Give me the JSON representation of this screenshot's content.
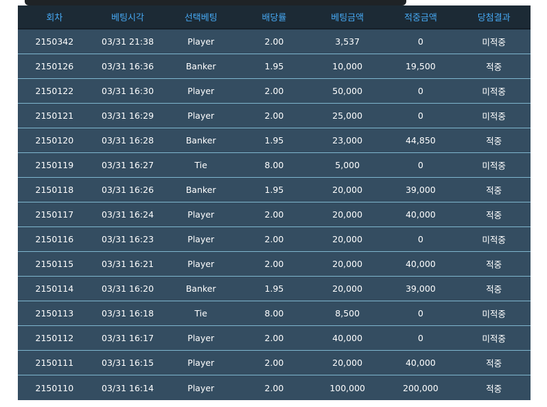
{
  "table": {
    "headers": [
      "회차",
      "베팅시각",
      "선택베팅",
      "배당률",
      "베팅금액",
      "적중금액",
      "당첨결과"
    ],
    "rows": [
      {
        "round": "2150342",
        "time": "03/31 21:38",
        "bet": "Player",
        "odds": "2.00",
        "amount": "3,537",
        "win_amount": "0",
        "result": "미적중",
        "status": "lose"
      },
      {
        "round": "2150126",
        "time": "03/31 16:36",
        "bet": "Banker",
        "odds": "1.95",
        "amount": "10,000",
        "win_amount": "19,500",
        "result": "적중",
        "status": "win"
      },
      {
        "round": "2150122",
        "time": "03/31 16:30",
        "bet": "Player",
        "odds": "2.00",
        "amount": "50,000",
        "win_amount": "0",
        "result": "미적중",
        "status": "lose"
      },
      {
        "round": "2150121",
        "time": "03/31 16:29",
        "bet": "Player",
        "odds": "2.00",
        "amount": "25,000",
        "win_amount": "0",
        "result": "미적중",
        "status": "lose"
      },
      {
        "round": "2150120",
        "time": "03/31 16:28",
        "bet": "Banker",
        "odds": "1.95",
        "amount": "23,000",
        "win_amount": "44,850",
        "result": "적중",
        "status": "win"
      },
      {
        "round": "2150119",
        "time": "03/31 16:27",
        "bet": "Tie",
        "odds": "8.00",
        "amount": "5,000",
        "win_amount": "0",
        "result": "미적중",
        "status": "lose"
      },
      {
        "round": "2150118",
        "time": "03/31 16:26",
        "bet": "Banker",
        "odds": "1.95",
        "amount": "20,000",
        "win_amount": "39,000",
        "result": "적중",
        "status": "win"
      },
      {
        "round": "2150117",
        "time": "03/31 16:24",
        "bet": "Player",
        "odds": "2.00",
        "amount": "20,000",
        "win_amount": "40,000",
        "result": "적중",
        "status": "win"
      },
      {
        "round": "2150116",
        "time": "03/31 16:23",
        "bet": "Player",
        "odds": "2.00",
        "amount": "20,000",
        "win_amount": "0",
        "result": "미적중",
        "status": "lose"
      },
      {
        "round": "2150115",
        "time": "03/31 16:21",
        "bet": "Player",
        "odds": "2.00",
        "amount": "20,000",
        "win_amount": "40,000",
        "result": "적중",
        "status": "win"
      },
      {
        "round": "2150114",
        "time": "03/31 16:20",
        "bet": "Banker",
        "odds": "1.95",
        "amount": "20,000",
        "win_amount": "39,000",
        "result": "적중",
        "status": "win"
      },
      {
        "round": "2150113",
        "time": "03/31 16:18",
        "bet": "Tie",
        "odds": "8.00",
        "amount": "8,500",
        "win_amount": "0",
        "result": "미적중",
        "status": "lose"
      },
      {
        "round": "2150112",
        "time": "03/31 16:17",
        "bet": "Player",
        "odds": "2.00",
        "amount": "40,000",
        "win_amount": "0",
        "result": "미적중",
        "status": "lose"
      },
      {
        "round": "2150111",
        "time": "03/31 16:15",
        "bet": "Player",
        "odds": "2.00",
        "amount": "20,000",
        "win_amount": "40,000",
        "result": "적중",
        "status": "win"
      },
      {
        "round": "2150110",
        "time": "03/31 16:14",
        "bet": "Player",
        "odds": "2.00",
        "amount": "100,000",
        "win_amount": "200,000",
        "result": "적중",
        "status": "win"
      }
    ]
  },
  "colors": {
    "header_bg": "#1c2a35",
    "header_text": "#46a8f2",
    "row_bg": "#344d61",
    "row_border": "#7fb7cf",
    "lose": "#e11f2c",
    "win": "#f5a623"
  }
}
